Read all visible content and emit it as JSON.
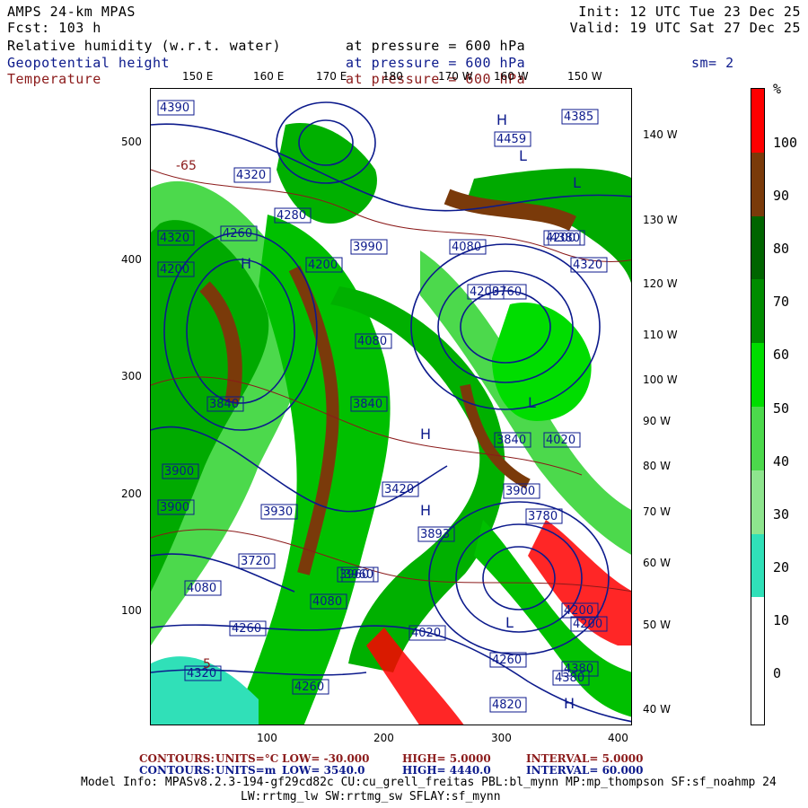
{
  "header": {
    "model": "AMPS 24-km MPAS",
    "init": "Init: 12 UTC Tue 23 Dec 25",
    "forecast": "Fcst:  103 h",
    "valid": "Valid: 19 UTC Sat 27 Dec 25",
    "fields": [
      {
        "name": "Relative humidity (w.r.t. water)",
        "pressure": "at pressure =  600 hPa",
        "color": "#000000"
      },
      {
        "name": "Geopotential height",
        "pressure": "at pressure =  600 hPa",
        "color": "#0c1a8c"
      },
      {
        "name": "Temperature",
        "pressure": "at pressure =  600 hPa",
        "color": "#8b1a1a"
      }
    ],
    "smoothing": "sm= 2"
  },
  "axes": {
    "x_ticks": [
      "100",
      "200",
      "300",
      "400"
    ],
    "y_ticks": [
      "500",
      "400",
      "300",
      "200",
      "100"
    ],
    "top_longitudes": [
      "150 E",
      "160 E",
      "170 E",
      "180",
      "170 W",
      "160 W",
      "150 W"
    ],
    "right_longitudes": [
      "140 W",
      "130 W",
      "120 W",
      "110 W",
      "100 W",
      "90 W",
      "80 W",
      "70 W",
      "60 W",
      "50 W",
      "40 W"
    ]
  },
  "colorbar": {
    "unit": "%",
    "labels": [
      "100",
      "90",
      "80",
      "70",
      "60",
      "50",
      "40",
      "30",
      "20",
      "10",
      "0"
    ],
    "segments": [
      {
        "range": "90-100",
        "color": "#ff0000"
      },
      {
        "range": "80-90",
        "color": "#7a3a0a"
      },
      {
        "range": "70-80",
        "color": "#006400"
      },
      {
        "range": "60-70",
        "color": "#008c00"
      },
      {
        "range": "50-60",
        "color": "#00dd00"
      },
      {
        "range": "40-50",
        "color": "#4cd94c"
      },
      {
        "range": "30-40",
        "color": "#8ee58e"
      },
      {
        "range": "20-30",
        "color": "#30e0b8"
      },
      {
        "range": "10-20",
        "color": "#ffffff"
      },
      {
        "range": "0-10",
        "color": "#ffffff"
      }
    ]
  },
  "map_labels": {
    "heights": [
      "4390",
      "4320",
      "4459",
      "4385",
      "4320",
      "4280",
      "4260",
      "4320",
      "4200",
      "4080",
      "4200",
      "4380",
      "4200",
      "3990",
      "4080",
      "4200",
      "3760",
      "3840",
      "3840",
      "4020",
      "3900",
      "3930",
      "3960",
      "3720",
      "4080",
      "3893",
      "3960",
      "4020",
      "4080",
      "4200",
      "4260",
      "4380",
      "4320",
      "4260",
      "4380",
      "4820",
      "3900",
      "3840",
      "3420",
      "3900",
      "3780",
      "4200",
      "4260"
    ],
    "highs": [
      "H",
      "H",
      "H",
      "H",
      "H"
    ],
    "lows": [
      "L",
      "L",
      "L",
      "L"
    ],
    "temps": [
      "-65",
      "5"
    ]
  },
  "footer": {
    "temp_contours": {
      "label": "CONTOURS:",
      "units": "UNITS=°C",
      "low": "LOW= -30.000",
      "high": "HIGH=  5.0000",
      "interval": "INTERVAL=   5.0000"
    },
    "gh_contours": {
      "label": "CONTOURS:",
      "units": "UNITS=m",
      "low": "LOW=  3540.0",
      "high": "HIGH= 4440.0",
      "interval": "INTERVAL=   60.000"
    },
    "model_info_1": "Model Info: MPASv8.2.3-194-gf29cd82c CU:cu_grell_freitas PBL:bl_mynn MP:mp_thompson SF:sf_noahmp 24",
    "model_info_2": "LW:rrtmg_lw SW:rrtmg_sw SFLAY:sf_mynn"
  }
}
